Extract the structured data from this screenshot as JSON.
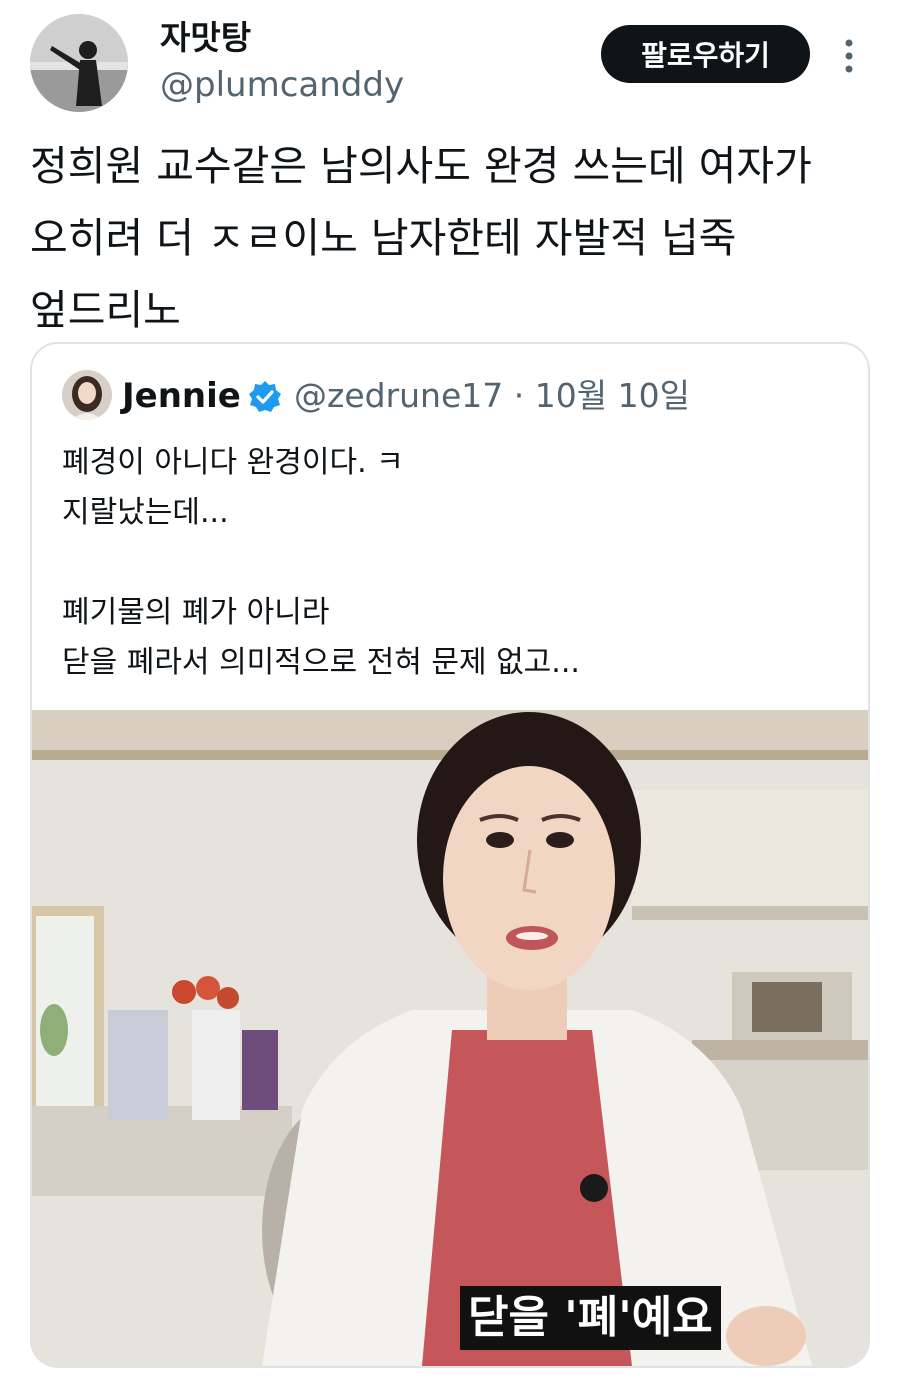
{
  "author": {
    "name": "자맛탕",
    "handle": "@plumcanddy"
  },
  "follow_label": "팔로우하기",
  "tweet_text": "정희원 교수같은 남의사도 완경 쓰는데 여자가\n오히려 더 ㅈㄹ이노 남자한테 자발적 넙죽\n엎드리노",
  "quote": {
    "name": "Jennie",
    "meta": "@zedrune17 · 10월 10일",
    "text": "폐경이 아니다 완경이다. ㅋ\n지랄났는데...\n\n폐기물의 폐가 아니라\n닫을 폐라서 의미적으로 전혀 문제 없고...",
    "media": {
      "subtitle": "닫을 '폐'예요"
    }
  },
  "icons": {
    "more": "more-vertical-icon",
    "verified": "verified-badge-icon"
  },
  "colors": {
    "text": "#0f1419",
    "secondary": "#536471",
    "follow_bg": "#0f1419",
    "verified": "#1d9bf0",
    "border": "#dfe3e6"
  }
}
